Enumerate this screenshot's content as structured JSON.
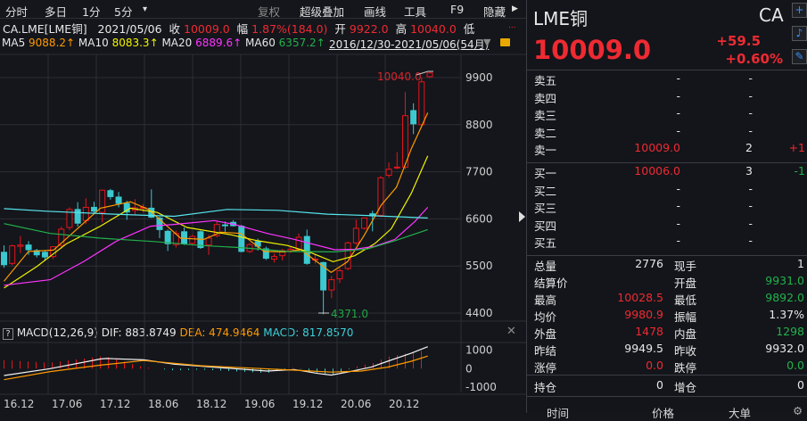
{
  "toolbar": {
    "left": [
      "分时",
      "多日",
      "1分",
      "5分"
    ],
    "dropdown_icon": "▾",
    "right": [
      "复权",
      "超级叠加",
      "画线",
      "工具",
      "F9",
      "隐藏"
    ]
  },
  "info": {
    "symbol": "CA.LME[LME铜]",
    "date": "2021/05/06",
    "close_label": "收",
    "close": "10009.0",
    "change_label": "幅",
    "change": "1.87%(184.0)",
    "open_label": "开",
    "open": "9922.0",
    "high_label": "高",
    "high": "10040.0",
    "low_label": "低",
    "more": "..."
  },
  "ma_legend": [
    {
      "label": "MA5",
      "value": "9088.2↑",
      "color": "#ff9a00"
    },
    {
      "label": "MA10",
      "value": "8083.3↑",
      "color": "#f2f200"
    },
    {
      "label": "MA20",
      "value": "6889.6↑",
      "color": "#ff33ff"
    },
    {
      "label": "MA60",
      "value": "6357.2↑",
      "color": "#22b14c"
    }
  ],
  "range_label": "2016/12/30-2021/05/06(54月)",
  "macd_legend": {
    "help": "?",
    "name": "MACD(12,26,9)",
    "dif": "DIF: 883.8749",
    "dea": "DEA: 474.9464",
    "macd": "MACD: 817.8570"
  },
  "chart_data": {
    "type": "candlestick",
    "title": "CA.LME[LME铜] monthly",
    "y_ticks": [
      "9900",
      "8800",
      "7700",
      "6600",
      "5500",
      "4400"
    ],
    "ylim": [
      4400,
      9900
    ],
    "x_ticks": [
      {
        "index": 0,
        "label": "16.12"
      },
      {
        "index": 6,
        "label": "17.06"
      },
      {
        "index": 12,
        "label": "17.12"
      },
      {
        "index": 18,
        "label": "18.06"
      },
      {
        "index": 24,
        "label": "18.12"
      },
      {
        "index": 30,
        "label": "19.06"
      },
      {
        "index": 36,
        "label": "19.12"
      },
      {
        "index": 42,
        "label": "20.06"
      },
      {
        "index": 48,
        "label": "20.12"
      }
    ],
    "max_label": "10040.0",
    "min_label": "4371.0",
    "ohlc": [
      [
        5820,
        5980,
        5460,
        5530
      ],
      [
        5560,
        6000,
        5520,
        5970
      ],
      [
        5960,
        6200,
        5800,
        5990
      ],
      [
        5990,
        6080,
        5760,
        5880
      ],
      [
        5860,
        5900,
        5700,
        5760
      ],
      [
        5820,
        5860,
        5620,
        5710
      ],
      [
        5720,
        5960,
        5660,
        5950
      ],
      [
        5980,
        6420,
        5900,
        6360
      ],
      [
        6400,
        6870,
        6340,
        6820
      ],
      [
        6820,
        6990,
        6420,
        6500
      ],
      [
        6560,
        7080,
        6480,
        6870
      ],
      [
        6870,
        7000,
        6720,
        6780
      ],
      [
        6750,
        7280,
        6520,
        7270
      ],
      [
        7260,
        7300,
        7050,
        7120
      ],
      [
        7110,
        7230,
        6870,
        6960
      ],
      [
        6960,
        7020,
        6580,
        6760
      ],
      [
        6800,
        7060,
        6700,
        6860
      ],
      [
        6850,
        6950,
        6750,
        6870
      ],
      [
        6850,
        7290,
        6620,
        6640
      ],
      [
        6620,
        6650,
        6150,
        6350
      ],
      [
        6310,
        6350,
        5850,
        6020
      ],
      [
        6000,
        6330,
        5930,
        6260
      ],
      [
        6300,
        6400,
        5990,
        6020
      ],
      [
        6030,
        6230,
        6000,
        6190
      ],
      [
        6300,
        6330,
        5900,
        5930
      ],
      [
        5990,
        6230,
        5760,
        6150
      ],
      [
        6210,
        6540,
        6170,
        6470
      ],
      [
        6460,
        6540,
        6300,
        6440
      ],
      [
        6520,
        6570,
        6420,
        6440
      ],
      [
        6430,
        6460,
        5820,
        5840
      ],
      [
        5840,
        6040,
        5800,
        6000
      ],
      [
        6070,
        6140,
        5860,
        5960
      ],
      [
        5900,
        5950,
        5640,
        5680
      ],
      [
        5660,
        5790,
        5580,
        5720
      ],
      [
        5740,
        5900,
        5630,
        5860
      ],
      [
        5840,
        5950,
        5800,
        5890
      ],
      [
        5880,
        6260,
        5850,
        6170
      ],
      [
        6190,
        6350,
        5530,
        5560
      ],
      [
        5640,
        5780,
        5560,
        5660
      ],
      [
        5580,
        5600,
        4371,
        4940
      ],
      [
        4940,
        5270,
        4750,
        5180
      ],
      [
        5200,
        5450,
        5100,
        5390
      ],
      [
        5440,
        6070,
        5400,
        6040
      ],
      [
        6040,
        6580,
        5990,
        6380
      ],
      [
        6380,
        6630,
        6350,
        6620
      ],
      [
        6720,
        6790,
        6310,
        6670
      ],
      [
        6680,
        7600,
        6640,
        7560
      ],
      [
        7620,
        7920,
        7560,
        7760
      ],
      [
        7790,
        8160,
        7760,
        7810
      ],
      [
        7810,
        9560,
        7760,
        9010
      ],
      [
        9130,
        9300,
        8580,
        8820
      ],
      [
        8800,
        9900,
        8740,
        9800
      ],
      [
        9922,
        10040,
        9892,
        10009
      ]
    ],
    "ma_series": [
      {
        "name": "MA5",
        "color": "#ff9a00",
        "points": [
          [
            0,
            5145
          ],
          [
            3.04,
            5840
          ],
          [
            6.17,
            5870
          ],
          [
            12,
            6850
          ],
          [
            15.75,
            7000
          ],
          [
            18,
            6820
          ],
          [
            22,
            6150
          ],
          [
            24.9,
            6120
          ],
          [
            27,
            6290
          ],
          [
            29.5,
            6260
          ],
          [
            32.4,
            5840
          ],
          [
            34.9,
            5830
          ],
          [
            37,
            5880
          ],
          [
            40.75,
            5350
          ],
          [
            42.8,
            5600
          ],
          [
            44.9,
            6220
          ],
          [
            47,
            6920
          ],
          [
            48.9,
            7340
          ],
          [
            50.75,
            8240
          ],
          [
            52.8,
            9080
          ]
        ]
      },
      {
        "name": "MA10",
        "color": "#f2f200",
        "points": [
          [
            0,
            4985
          ],
          [
            4.1,
            5490
          ],
          [
            7.8,
            6020
          ],
          [
            12,
            6430
          ],
          [
            15.75,
            6850
          ],
          [
            19.1,
            6750
          ],
          [
            22.8,
            6400
          ],
          [
            28.25,
            6230
          ],
          [
            31.6,
            6090
          ],
          [
            35.3,
            5980
          ],
          [
            38.25,
            5810
          ],
          [
            41,
            5600
          ],
          [
            43.7,
            5740
          ],
          [
            46.2,
            6020
          ],
          [
            48.25,
            6370
          ],
          [
            50.75,
            7200
          ],
          [
            52.8,
            8070
          ]
        ]
      },
      {
        "name": "MA20",
        "color": "#ff33ff",
        "points": [
          [
            0,
            5050
          ],
          [
            5.75,
            5180
          ],
          [
            9.9,
            5600
          ],
          [
            14.1,
            6090
          ],
          [
            18.25,
            6430
          ],
          [
            21.2,
            6470
          ],
          [
            26.2,
            6560
          ],
          [
            28.7,
            6470
          ],
          [
            32.8,
            6260
          ],
          [
            36.2,
            6120
          ],
          [
            41.2,
            5880
          ],
          [
            43.7,
            5890
          ],
          [
            46.2,
            5960
          ],
          [
            48.7,
            6120
          ],
          [
            51.2,
            6540
          ],
          [
            52.8,
            6870
          ]
        ]
      },
      {
        "name": "MA60",
        "color": "#22b14c",
        "points": [
          [
            0,
            6490
          ],
          [
            5.75,
            6260
          ],
          [
            12,
            6150
          ],
          [
            18.7,
            6070
          ],
          [
            24.5,
            5980
          ],
          [
            29.5,
            5930
          ],
          [
            35.3,
            5840
          ],
          [
            41.2,
            5830
          ],
          [
            45.3,
            5900
          ],
          [
            48.7,
            6090
          ],
          [
            52.8,
            6350
          ]
        ]
      },
      {
        "name": "",
        "color": "#56e6ec",
        "points": [
          [
            0,
            6840
          ],
          [
            5.3,
            6780
          ],
          [
            13.7,
            6710
          ],
          [
            21.2,
            6660
          ],
          [
            27.8,
            6820
          ],
          [
            34.1,
            6800
          ],
          [
            40.3,
            6710
          ],
          [
            45.3,
            6680
          ],
          [
            52.8,
            6620
          ]
        ]
      }
    ],
    "macd": {
      "y_ticks": [
        "1000",
        "0",
        "-1000"
      ],
      "dif": [
        [
          0,
          -370
        ],
        [
          5.75,
          0
        ],
        [
          12,
          520
        ],
        [
          12.8,
          550
        ],
        [
          17.4,
          480
        ],
        [
          21.2,
          240
        ],
        [
          28.7,
          0
        ],
        [
          32.8,
          -130
        ],
        [
          36.2,
          -50
        ],
        [
          39.1,
          -260
        ],
        [
          40.75,
          -350
        ],
        [
          42.8,
          -190
        ],
        [
          45.75,
          80
        ],
        [
          47.8,
          400
        ],
        [
          50.75,
          840
        ],
        [
          52.8,
          1190
        ]
      ],
      "dea": [
        [
          0,
          -600
        ],
        [
          5.75,
          -160
        ],
        [
          12,
          190
        ],
        [
          17.4,
          440
        ],
        [
          24.5,
          160
        ],
        [
          30.75,
          30
        ],
        [
          36.2,
          -80
        ],
        [
          40.75,
          -190
        ],
        [
          44.5,
          -130
        ],
        [
          47.8,
          80
        ],
        [
          50.75,
          400
        ],
        [
          52.8,
          680
        ]
      ]
    }
  },
  "quote": {
    "name": "LME铜",
    "code": "CA",
    "price": "10009.0",
    "change": "+59.5",
    "change_pct": "+0.60%",
    "icons": [
      "plus-icon",
      "bell-icon",
      "pencil-icon"
    ],
    "asks": [
      {
        "label": "卖五",
        "price": "-",
        "qty": "-",
        "delta": ""
      },
      {
        "label": "卖四",
        "price": "-",
        "qty": "-",
        "delta": ""
      },
      {
        "label": "卖三",
        "price": "-",
        "qty": "-",
        "delta": ""
      },
      {
        "label": "卖二",
        "price": "-",
        "qty": "-",
        "delta": ""
      },
      {
        "label": "卖一",
        "price": "10009.0",
        "qty": "2",
        "delta": "+1"
      }
    ],
    "bids": [
      {
        "label": "买一",
        "price": "10006.0",
        "qty": "3",
        "delta": "-1"
      },
      {
        "label": "买二",
        "price": "-",
        "qty": "-",
        "delta": ""
      },
      {
        "label": "买三",
        "price": "-",
        "qty": "-",
        "delta": ""
      },
      {
        "label": "买四",
        "price": "-",
        "qty": "-",
        "delta": ""
      },
      {
        "label": "买五",
        "price": "-",
        "qty": "-",
        "delta": ""
      }
    ],
    "stats": [
      {
        "l1": "总量",
        "v1": "2776",
        "c1": "#e8e8e8",
        "l2": "现手",
        "v2": "1",
        "c2": "#e8e8e8"
      },
      {
        "l1": "结算价",
        "v1": "",
        "c1": "#e8e8e8",
        "l2": "开盘",
        "v2": "9931.0",
        "c2": "#22b14c"
      },
      {
        "l1": "最高",
        "v1": "10028.5",
        "c1": "#ee2a32",
        "l2": "最低",
        "v2": "9892.0",
        "c2": "#22b14c"
      },
      {
        "l1": "均价",
        "v1": "9980.9",
        "c1": "#ee2a32",
        "l2": "振幅",
        "v2": "1.37%",
        "c2": "#e8e8e8"
      },
      {
        "l1": "外盘",
        "v1": "1478",
        "c1": "#ee2a32",
        "l2": "内盘",
        "v2": "1298",
        "c2": "#22b14c"
      },
      {
        "l1": "昨结",
        "v1": "9949.5",
        "c1": "#e8e8e8",
        "l2": "昨收",
        "v2": "9932.0",
        "c2": "#e8e8e8"
      },
      {
        "l1": "涨停",
        "v1": "0.0",
        "c1": "#ee2a32",
        "l2": "跌停",
        "v2": "0.0",
        "c2": "#22b14c"
      }
    ],
    "position": {
      "l1": "持仓",
      "v1": "0",
      "l2": "增仓",
      "v2": "0"
    },
    "trade_header": [
      "时间",
      "价格",
      "大单"
    ]
  }
}
